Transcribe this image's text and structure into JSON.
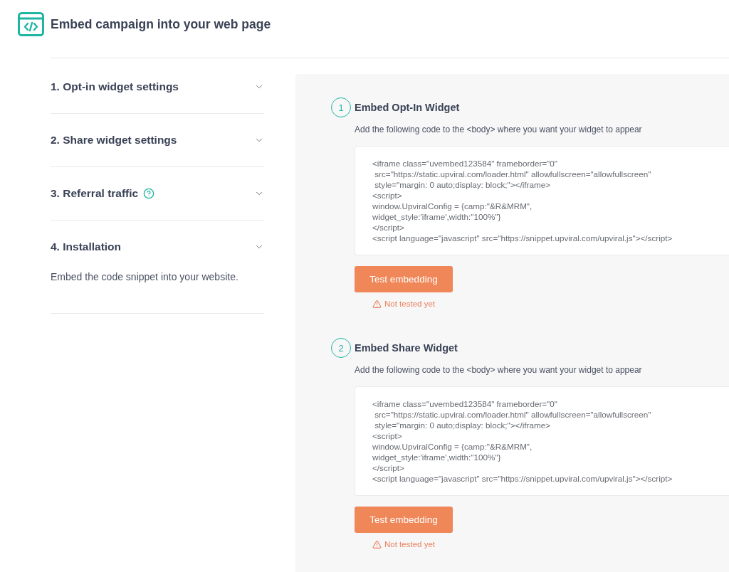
{
  "header": {
    "title": "Embed campaign into your web page"
  },
  "accordion": [
    {
      "title": "1. Opt-in widget settings",
      "help_icon": false
    },
    {
      "title": "2. Share widget settings",
      "help_icon": false
    },
    {
      "title": "3. Referral traffic",
      "help_icon": true
    },
    {
      "title": "4. Installation",
      "help_icon": false,
      "description": "Embed the code snippet into your website."
    }
  ],
  "steps": [
    {
      "number": "1",
      "title": "Embed Opt-In Widget",
      "instruction": "Add the following code to the <body> where you want your widget to appear",
      "code": "<iframe class=\"uvembed123584\" frameborder=\"0\"\n src=\"https://static.upviral.com/loader.html\" allowfullscreen=\"allowfullscreen\"\n style=\"margin: 0 auto;display: block;\"></iframe>\n<script>\nwindow.UpviralConfig = {camp:\"&R&MRM\",\nwidget_style:'iframe',width:\"100%\"}\n</script>\n<script language=\"javascript\" src=\"https://snippet.upviral.com/upviral.js\"></script>",
      "button": "Test embedding",
      "tested": false,
      "status": "Not tested yet"
    },
    {
      "number": "2",
      "title": "Embed Share Widget",
      "instruction": "Add the following code to the <body> where you want your widget to appear",
      "code": "<iframe class=\"uvembed123584\" frameborder=\"0\"\n src=\"https://static.upviral.com/loader.html\" allowfullscreen=\"allowfullscreen\"\n style=\"margin: 0 auto;display: block;\"></iframe>\n<script>\nwindow.UpviralConfig = {camp:\"&R&MRM\",\nwidget_style:'iframe',width:\"100%\"}\n</script>\n<script language=\"javascript\" src=\"https://snippet.upviral.com/upviral.js\"></script>",
      "button": "Test embedding",
      "tested": false,
      "status": "Not tested yet"
    }
  ]
}
